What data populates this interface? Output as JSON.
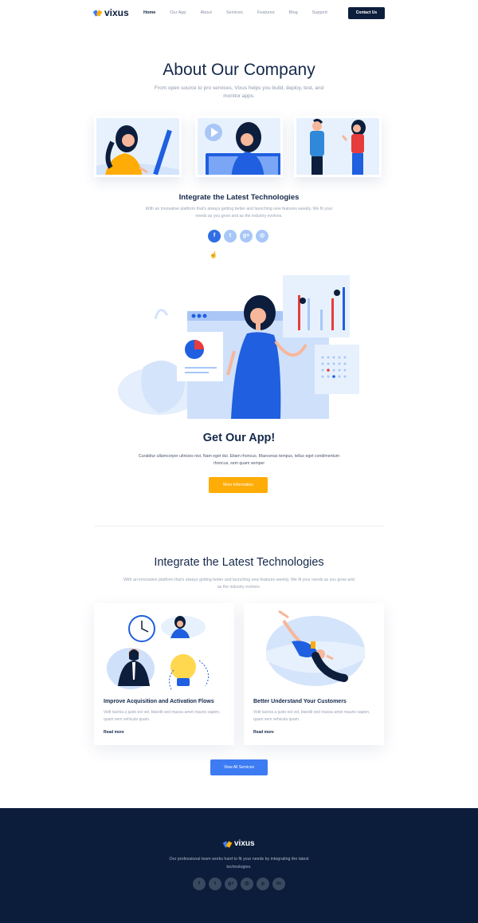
{
  "brand": {
    "name": "vixus",
    "colors": {
      "navy": "#0c1e3c",
      "accent_blue": "#3d7bf3",
      "accent_orange": "#ffac06",
      "facebook": "#2f6ee5",
      "light_blue": "#a8c7f8"
    }
  },
  "nav": {
    "items": [
      "Home",
      "Our App",
      "About",
      "Services",
      "Features",
      "Blog",
      "Support"
    ],
    "active": "Home",
    "contact_label": "Contact Us"
  },
  "about": {
    "title": "About Our Company",
    "subtitle": "From open source to pro services, Vixus helps you build, deploy, test, and monitor apps."
  },
  "integrate_small": {
    "title": "Integrate the Latest Technologies",
    "text": "With an innovative platform that's always getting better and launching new features weekly. We fit your needs as you grow and as the industry evolves.",
    "social_icons": [
      "facebook-icon",
      "twitter-icon",
      "google-plus-icon",
      "instagram-icon"
    ],
    "social_glyphs": [
      "f",
      "t",
      "g+",
      "◎"
    ]
  },
  "app": {
    "title": "Get Our App!",
    "text": "Curabitur ullamcorper ultricies nisi. Nam eget dui. Etiam rhoncus. Maecenas tempus, tellus eget condimentum rhoncus, sem quam semper",
    "button": "More Information"
  },
  "services": {
    "title": "Integrate the Latest Technologies",
    "text": "With an innovative platform that's always getting better and launching new features weekly. We fit your needs as you grow and as the industry evolves.",
    "cards": [
      {
        "title": "Improve Acquisition and Activation Flows",
        "text": "Velit lacinia a justo est vel, blandit sed massa amet mauris sapien, quam sem vehicula quam.",
        "link": "Read more"
      },
      {
        "title": "Better Understand Your Customers",
        "text": "Velit lacinia a justo est vel, blandit sed massa amet mauris sapien, quam sem vehicula quam.",
        "link": "Read more"
      }
    ],
    "button": "View All Services"
  },
  "footer": {
    "brand": "vixus",
    "text": "Our professional team works hard to fit your needs by integrating the latest technologies.",
    "social_icons": [
      "facebook-icon",
      "twitter-icon",
      "google-plus-icon",
      "instagram-icon",
      "pinterest-icon",
      "linkedin-icon"
    ],
    "social_glyphs": [
      "f",
      "t",
      "g+",
      "◎",
      "p",
      "in"
    ]
  }
}
